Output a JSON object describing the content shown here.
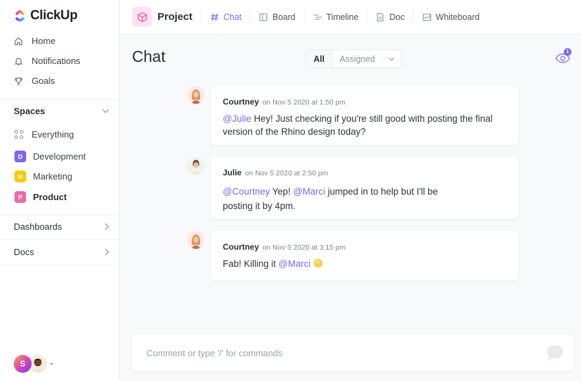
{
  "app": {
    "name": "ClickUp",
    "brand_colors": {
      "accent": "#7b68ee",
      "logo_gradient": [
        "#ff02f0",
        "#8930fd",
        "#49ccf9"
      ]
    }
  },
  "sidebar": {
    "nav": [
      {
        "label": "Home",
        "icon": "home-icon"
      },
      {
        "label": "Notifications",
        "icon": "bell-icon"
      },
      {
        "label": "Goals",
        "icon": "trophy-icon"
      }
    ],
    "spaces_header": "Spaces",
    "everything_label": "Everything",
    "spaces": [
      {
        "letter": "D",
        "label": "Development",
        "color": "#7b68ee",
        "active": false
      },
      {
        "letter": "M",
        "label": "Marketing",
        "color": "#ffc800",
        "active": false
      },
      {
        "letter": "P",
        "label": "Product",
        "color": "#f06aa7",
        "active": true
      }
    ],
    "sections": [
      {
        "label": "Dashboards"
      },
      {
        "label": "Docs"
      }
    ],
    "user": {
      "initial": "S"
    }
  },
  "header": {
    "project": "Project",
    "views": [
      {
        "label": "Chat",
        "icon": "hash-icon",
        "active": true
      },
      {
        "label": "Board",
        "icon": "board-icon",
        "active": false
      },
      {
        "label": "Timeline",
        "icon": "timeline-icon",
        "active": false
      },
      {
        "label": "Doc",
        "icon": "doc-icon",
        "active": false
      },
      {
        "label": "Whiteboard",
        "icon": "whiteboard-icon",
        "active": false
      }
    ]
  },
  "main": {
    "title": "Chat",
    "filters": {
      "all": "All",
      "assigned": "Assigned"
    },
    "watchers_count": "1",
    "messages": [
      {
        "author": "Courtney",
        "time": "on Nov 5 2020 at 1:50 pm",
        "parts": [
          {
            "type": "mention",
            "text": "@Julie"
          },
          {
            "type": "text",
            "text": " Hey! Just checking if you're still good with posting the final version of the Rhino design today?"
          }
        ]
      },
      {
        "author": "Julie",
        "time": "on Nov 5 2020 at 2:50 pm",
        "parts": [
          {
            "type": "mention",
            "text": "@Courtney"
          },
          {
            "type": "text",
            "text": " Yep! "
          },
          {
            "type": "mention",
            "text": "@Marci"
          },
          {
            "type": "text",
            "text": " jumped in to help but I'll be posting it by 4pm."
          }
        ]
      },
      {
        "author": "Courtney",
        "time": "on Nov 5 2020 at 3:15 pm",
        "parts": [
          {
            "type": "text",
            "text": "Fab! Killing it "
          },
          {
            "type": "mention",
            "text": "@Marci"
          },
          {
            "type": "emoji",
            "text": "slightly-smiling-face"
          }
        ]
      }
    ],
    "composer": {
      "placeholder": "Comment or type '/' for commands",
      "value": ""
    }
  }
}
